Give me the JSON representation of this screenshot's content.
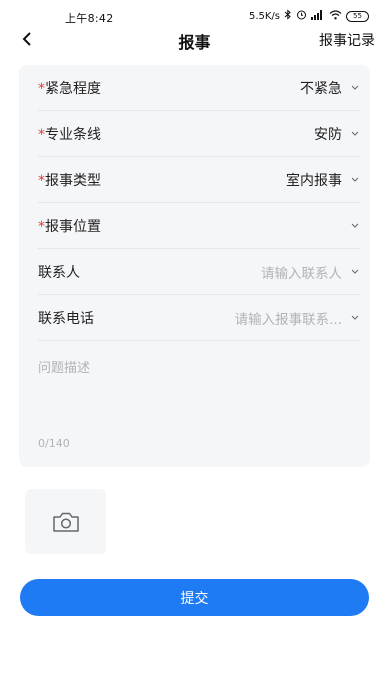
{
  "status_bar": {
    "time": "上午8:42",
    "network_speed": "5.5K/s",
    "battery": "55",
    "icons": [
      "bluetooth-icon",
      "alarm-icon",
      "signal-icon",
      "wifi-icon",
      "battery-icon"
    ]
  },
  "header": {
    "back_icon": "chevron-left-icon",
    "title": "报事",
    "action_label": "报事记录"
  },
  "form": {
    "rows": [
      {
        "required": true,
        "label": "紧急程度",
        "value": "不紧急",
        "is_placeholder": false
      },
      {
        "required": true,
        "label": "专业条线",
        "value": "安防",
        "is_placeholder": false
      },
      {
        "required": true,
        "label": "报事类型",
        "value": "室内报事",
        "is_placeholder": false
      },
      {
        "required": true,
        "label": "报事位置",
        "value": "",
        "is_placeholder": false
      },
      {
        "required": false,
        "label": "联系人",
        "value": "请输入联系人",
        "is_placeholder": true
      },
      {
        "required": false,
        "label": "联系电话",
        "value": "请输入报事联系...",
        "is_placeholder": true
      }
    ],
    "required_mark": "*",
    "description": {
      "placeholder": "问题描述",
      "counter": "0/140"
    }
  },
  "photo_upload": {
    "icon": "camera-icon"
  },
  "submit_label": "提交",
  "colors": {
    "primary": "#1f7bf4",
    "required": "#e53935",
    "card_bg": "#f5f6f8",
    "placeholder": "#b0b3b8"
  }
}
